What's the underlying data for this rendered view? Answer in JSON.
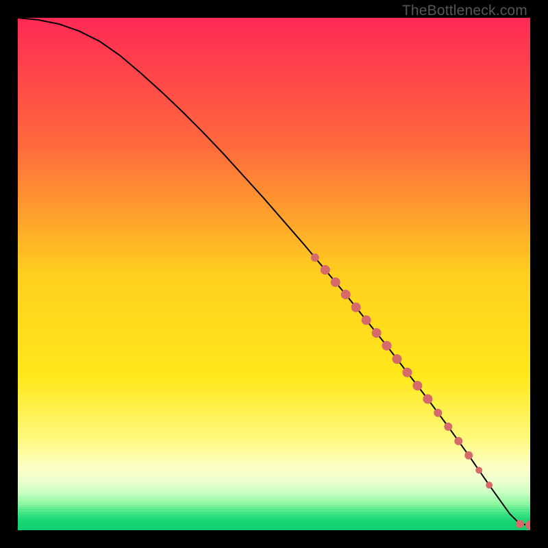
{
  "watermark": "TheBottleneck.com",
  "colors": {
    "point": "#d66a6a",
    "line": "#000000",
    "bg": "#000000"
  },
  "gradient_stops": [
    {
      "pct": 0,
      "color": "#ff2a55"
    },
    {
      "pct": 25,
      "color": "#ff6a3c"
    },
    {
      "pct": 50,
      "color": "#ffcf1f"
    },
    {
      "pct": 70,
      "color": "#ffe81a"
    },
    {
      "pct": 82,
      "color": "#fff97a"
    },
    {
      "pct": 88,
      "color": "#fdffc8"
    },
    {
      "pct": 91,
      "color": "#e8ffce"
    },
    {
      "pct": 93,
      "color": "#c6ffc2"
    },
    {
      "pct": 95,
      "color": "#8ef7a0"
    },
    {
      "pct": 96.5,
      "color": "#4fe88a"
    },
    {
      "pct": 98,
      "color": "#1ed978"
    },
    {
      "pct": 100,
      "color": "#0fd070"
    }
  ],
  "chart_data": {
    "type": "line",
    "title": "",
    "xlabel": "",
    "ylabel": "",
    "xlim": [
      0,
      100
    ],
    "ylim": [
      0,
      100
    ],
    "series": [
      {
        "name": "curve",
        "x": [
          0,
          4,
          8,
          12,
          16,
          20,
          24,
          28,
          32,
          36,
          40,
          44,
          48,
          52,
          56,
          60,
          64,
          68,
          72,
          76,
          80,
          84,
          88,
          92,
          96,
          98,
          100
        ],
        "y": [
          100,
          99.6,
          98.8,
          97.4,
          95.4,
          92.6,
          89.2,
          85.6,
          81.8,
          77.8,
          73.6,
          69.2,
          64.8,
          60.2,
          55.6,
          50.8,
          46.0,
          41.0,
          36.0,
          30.8,
          25.6,
          20.2,
          14.6,
          8.8,
          3.2,
          1.2,
          1.0
        ]
      }
    ],
    "highlight_points": {
      "name": "dense-segment",
      "x": [
        58,
        60,
        62,
        64,
        66,
        68,
        70,
        72,
        74,
        76,
        78,
        80,
        82,
        84,
        86,
        88,
        90,
        92,
        98,
        100
      ],
      "y": [
        53.2,
        50.8,
        48.4,
        46.0,
        43.5,
        41.0,
        38.5,
        36.0,
        33.4,
        30.8,
        28.2,
        25.6,
        22.9,
        20.2,
        17.4,
        14.6,
        11.7,
        8.8,
        1.2,
        1.0
      ],
      "r": [
        6,
        7,
        7,
        7,
        7,
        7,
        7,
        7,
        7,
        7,
        7,
        7,
        6,
        6,
        6,
        6,
        5,
        5,
        6,
        7
      ]
    }
  }
}
